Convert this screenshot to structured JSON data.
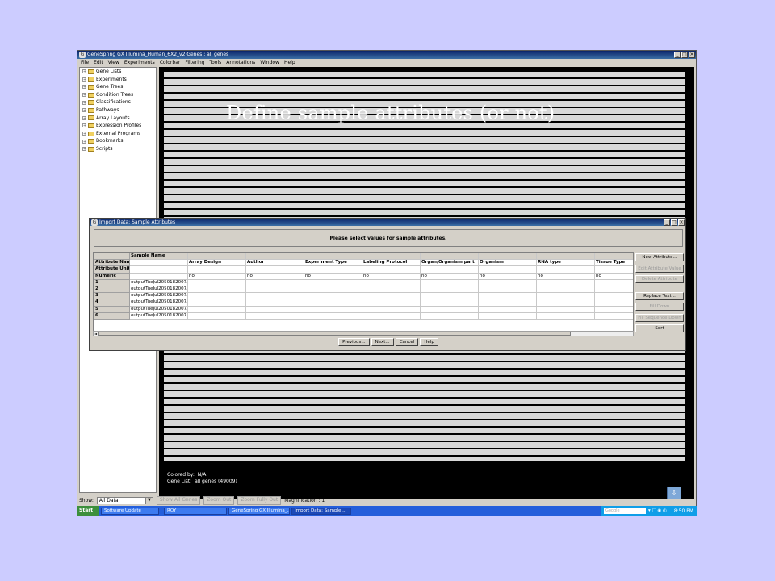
{
  "window": {
    "title": "GeneSpring GX Illumina_Human_6X2_v2 Genes : all genes"
  },
  "menu": [
    "File",
    "Edit",
    "View",
    "Experiments",
    "Colorbar",
    "Filtering",
    "Tools",
    "Annotations",
    "Window",
    "Help"
  ],
  "tree": [
    "Gene Lists",
    "Experiments",
    "Gene Trees",
    "Condition Trees",
    "Classifications",
    "Pathways",
    "Array Layouts",
    "Expression Profiles",
    "External Programs",
    "Bookmarks",
    "Scripts"
  ],
  "overlay_title": "Define sample attributes (or not)",
  "status": {
    "colored_by_label": "Colored by:",
    "colored_by_value": "N/A",
    "gene_list_label": "Gene List:",
    "gene_list_value": "all genes (49009)"
  },
  "bottombar": {
    "show_label": "Show:",
    "show_value": "All Data",
    "show_all_genes": "Show All Genes",
    "zoom_out": "Zoom Out",
    "zoom_fully_out": "Zoom Fully Out",
    "magnification": "Magnification : 1"
  },
  "dialog": {
    "title": "Import Data: Sample Attributes",
    "prompt": "Please select values for sample attributes.",
    "table": {
      "sample_name_header": "Sample Name",
      "row_header_labels": [
        "Attribute Name",
        "Attribute Units",
        "Numeric"
      ],
      "attribute_names": [
        "Array Design",
        "Author",
        "Experiment Type",
        "Labeling Protocol",
        "Organ/Organism part",
        "Organism",
        "RNA type",
        "Tissue Type"
      ],
      "numeric_values": [
        "no",
        "no",
        "no",
        "no",
        "no",
        "no",
        "no",
        "no"
      ],
      "rows": [
        {
          "num": "1",
          "sample": "outputTueJul2050182007.("
        },
        {
          "num": "2",
          "sample": "outputTueJul2050182007.("
        },
        {
          "num": "3",
          "sample": "outputTueJul2050182007.("
        },
        {
          "num": "4",
          "sample": "outputTueJul2050182007.("
        },
        {
          "num": "5",
          "sample": "outputTueJul2050182007.("
        },
        {
          "num": "6",
          "sample": "outputTueJul2050182007.("
        }
      ]
    },
    "side_buttons": [
      "New Attribute...",
      "Edit Attribute Value",
      "Delete Attribute",
      "Replace Text...",
      "Fill Down",
      "Fill Sequence Down",
      "Sort"
    ],
    "nav_buttons": [
      "Previous...",
      "Next...",
      "Cancel",
      "Help"
    ]
  },
  "taskbar": {
    "start": "Start",
    "tasks": [
      "Software Update",
      "ROY",
      "GeneSpring GX Illumina_...",
      "Import Data: Sample ..."
    ],
    "search_placeholder": "Google",
    "time": "8:50 PM"
  }
}
